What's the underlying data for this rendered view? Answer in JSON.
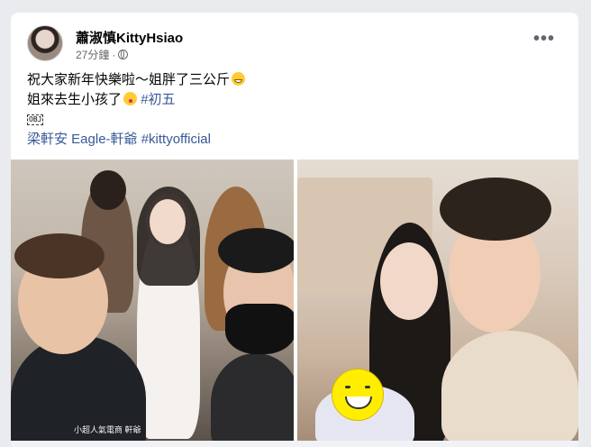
{
  "post": {
    "author": "蕭淑慎KittyHsiao",
    "time": "27分鐘",
    "dot": "·",
    "more_label": "•••",
    "lines": {
      "l1": "祝大家新年快樂啦～姐胖了三公斤",
      "l2": "姐來去生小孩了",
      "l2_tag": "#初五",
      "l3": "OBJ",
      "l4_mentions": "梁軒安 Eagle-軒爺 #kittyofficial"
    }
  },
  "photos": [
    {
      "caption": "小超人氣電商 軒爺"
    },
    {
      "caption": ""
    }
  ],
  "icons": {
    "avatar": "profile-photo",
    "globe": "globe-icon",
    "more": "more-options-icon",
    "emoji_grin": "grinning-face-icon",
    "emoji_kiss": "kissing-face-icon"
  },
  "colors": {
    "link": "#385898",
    "meta": "#65676b",
    "text": "#050505"
  }
}
